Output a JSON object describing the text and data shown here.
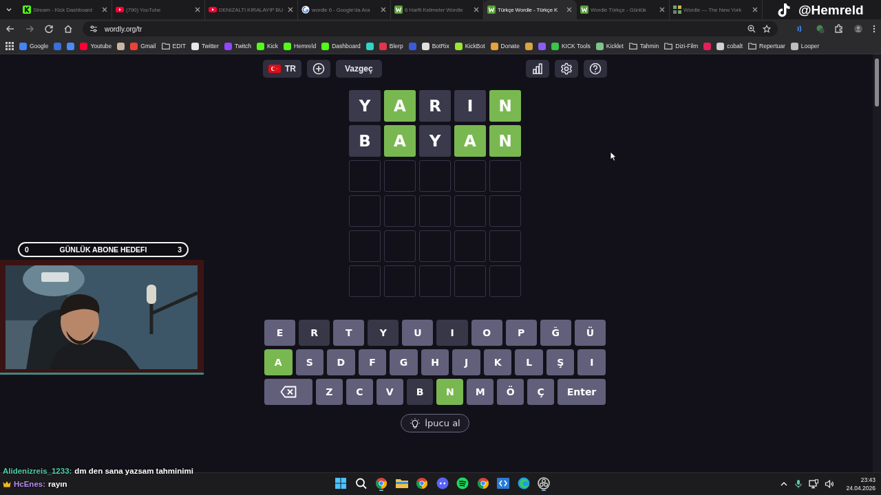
{
  "browser": {
    "tabs": [
      {
        "title": "Stream - Kick Dashboard",
        "kind": "kick",
        "selected": false
      },
      {
        "title": "(790) YouTube",
        "kind": "youtube",
        "selected": false
      },
      {
        "title": "DENIZALTI KIRALAYIP BU",
        "kind": "youtube",
        "selected": false
      },
      {
        "title": "wordle 6 - Google'da Ara",
        "kind": "google",
        "selected": false
      },
      {
        "title": "6 Harfli Kelimeler Wordle",
        "kind": "wordle",
        "selected": false
      },
      {
        "title": "Türkçe Wordle - Türkçe K",
        "kind": "wordle",
        "selected": true
      },
      {
        "title": "Wordle Türkçe - Günlük",
        "kind": "wordle",
        "selected": false
      },
      {
        "title": "Wordle — The New York",
        "kind": "grid",
        "selected": false
      }
    ],
    "address": "wordly.org/tr",
    "bookmarks": [
      {
        "label": "Google",
        "kind": "site",
        "color": "#4285f4"
      },
      {
        "kind": "site",
        "color": "#3b6fd8"
      },
      {
        "kind": "site",
        "color": "#4a8af4"
      },
      {
        "label": "Youtube",
        "kind": "site",
        "color": "#ff0033"
      },
      {
        "kind": "site",
        "color": "#c8b7a0"
      },
      {
        "label": "Gmail",
        "kind": "site",
        "color": "#ea4335"
      },
      {
        "label": "EDIT",
        "kind": "folder",
        "color": "#c7c7c7"
      },
      {
        "label": "Twitter",
        "kind": "site",
        "color": "#e7e7e7"
      },
      {
        "label": "Twitch",
        "kind": "site",
        "color": "#9146ff"
      },
      {
        "label": "Kick",
        "kind": "site",
        "color": "#53fc18"
      },
      {
        "label": "Hemreld",
        "kind": "site",
        "color": "#53fc18"
      },
      {
        "label": "Dashboard",
        "kind": "site",
        "color": "#53fc18"
      },
      {
        "kind": "site",
        "color": "#2fd6c4"
      },
      {
        "label": "Blerp",
        "kind": "site",
        "color": "#e5334b"
      },
      {
        "kind": "site",
        "color": "#3b5bdb"
      },
      {
        "label": "BotRix",
        "kind": "site",
        "color": "#e0e0e0"
      },
      {
        "label": "KickBot",
        "kind": "site",
        "color": "#9be52f"
      },
      {
        "label": "Donate",
        "kind": "site",
        "color": "#e8a23a"
      },
      {
        "kind": "site",
        "color": "#d9a441"
      },
      {
        "kind": "site",
        "color": "#8b5cf6"
      },
      {
        "label": "KICK Tools",
        "kind": "site",
        "color": "#37c74b"
      },
      {
        "label": "Kicklet",
        "kind": "site",
        "color": "#7fc48a"
      },
      {
        "label": "Tahmin",
        "kind": "folder",
        "color": "#c7c7c7"
      },
      {
        "label": "Dizi-Film",
        "kind": "folder",
        "color": "#c7c7c7"
      },
      {
        "kind": "site",
        "color": "#e0215b"
      },
      {
        "label": "cobalt",
        "kind": "site",
        "color": "#d0d0d0"
      },
      {
        "label": "Repertuar",
        "kind": "folder",
        "color": "#c7c7c7"
      },
      {
        "label": "Looper",
        "kind": "site",
        "color": "#bdbdbd"
      }
    ]
  },
  "overlay": {
    "handle": "@Hemreld",
    "goal": {
      "start": "0",
      "label": "GÜNLÜK ABONE HEDEFI",
      "end": "3"
    },
    "chat": [
      {
        "user": "Alidenizreis_1233:",
        "message": "dm den sana yazsam tahminimi",
        "color": "#4fd1a5",
        "crown": false
      },
      {
        "user": "HcEnes:",
        "message": "rayın",
        "color": "#b98cf2",
        "crown": true
      }
    ]
  },
  "game": {
    "language": "TR",
    "give_up": "Vazgeç",
    "hint": "İpucu al",
    "board": [
      [
        {
          "kind": "letter",
          "letter": "Y",
          "correct": false
        },
        {
          "kind": "letter",
          "letter": "A",
          "correct": true
        },
        {
          "kind": "letter",
          "letter": "R",
          "correct": false
        },
        {
          "kind": "letter",
          "letter": "I",
          "correct": false
        },
        {
          "kind": "letter",
          "letter": "N",
          "correct": true
        }
      ],
      [
        {
          "kind": "letter",
          "letter": "B",
          "correct": false
        },
        {
          "kind": "letter",
          "letter": "A",
          "correct": true
        },
        {
          "kind": "letter",
          "letter": "Y",
          "correct": false
        },
        {
          "kind": "letter",
          "letter": "A",
          "correct": true
        },
        {
          "kind": "letter",
          "letter": "N",
          "correct": true
        }
      ],
      [
        {
          "kind": "empty"
        },
        {
          "kind": "empty"
        },
        {
          "kind": "empty"
        },
        {
          "kind": "empty"
        },
        {
          "kind": "empty"
        }
      ],
      [
        {
          "kind": "empty"
        },
        {
          "kind": "empty"
        },
        {
          "kind": "empty"
        },
        {
          "kind": "empty"
        },
        {
          "kind": "empty"
        }
      ],
      [
        {
          "kind": "empty"
        },
        {
          "kind": "empty"
        },
        {
          "kind": "empty"
        },
        {
          "kind": "empty"
        },
        {
          "kind": "empty"
        }
      ],
      [
        {
          "kind": "empty"
        },
        {
          "kind": "empty"
        },
        {
          "kind": "empty"
        },
        {
          "kind": "empty"
        },
        {
          "kind": "empty"
        }
      ]
    ],
    "keyboard": [
      [
        {
          "kind": "letter",
          "label": "E",
          "correct": false,
          "absent": false
        },
        {
          "kind": "letter",
          "label": "R",
          "correct": false,
          "absent": true
        },
        {
          "kind": "letter",
          "label": "T",
          "correct": false,
          "absent": false
        },
        {
          "kind": "letter",
          "label": "Y",
          "correct": false,
          "absent": true
        },
        {
          "kind": "letter",
          "label": "U",
          "correct": false,
          "absent": false
        },
        {
          "kind": "letter",
          "label": "I",
          "correct": false,
          "absent": true
        },
        {
          "kind": "letter",
          "label": "O",
          "correct": false,
          "absent": false
        },
        {
          "kind": "letter",
          "label": "P",
          "correct": false,
          "absent": false
        },
        {
          "kind": "letter",
          "label": "Ğ",
          "correct": false,
          "absent": false
        },
        {
          "kind": "letter",
          "label": "Ü",
          "correct": false,
          "absent": false
        }
      ],
      [
        {
          "kind": "letter",
          "label": "A",
          "correct": true
        },
        {
          "kind": "letter",
          "label": "S",
          "correct": false,
          "absent": false
        },
        {
          "kind": "letter",
          "label": "D",
          "correct": false,
          "absent": false
        },
        {
          "kind": "letter",
          "label": "F",
          "correct": false,
          "absent": false
        },
        {
          "kind": "letter",
          "label": "G",
          "correct": false,
          "absent": false
        },
        {
          "kind": "letter",
          "label": "H",
          "correct": false,
          "absent": false
        },
        {
          "kind": "letter",
          "label": "J",
          "correct": false,
          "absent": false
        },
        {
          "kind": "letter",
          "label": "K",
          "correct": false,
          "absent": false
        },
        {
          "kind": "letter",
          "label": "L",
          "correct": false,
          "absent": false
        },
        {
          "kind": "letter",
          "label": "Ş",
          "correct": false,
          "absent": false
        },
        {
          "kind": "letter",
          "label": "I",
          "correct": false,
          "absent": false
        }
      ],
      [
        {
          "kind": "backspace"
        },
        {
          "kind": "letter",
          "label": "Z",
          "correct": false,
          "absent": false
        },
        {
          "kind": "letter",
          "label": "C",
          "correct": false,
          "absent": false
        },
        {
          "kind": "letter",
          "label": "V",
          "correct": false,
          "absent": false
        },
        {
          "kind": "letter",
          "label": "B",
          "correct": false,
          "absent": true
        },
        {
          "kind": "letter",
          "label": "N",
          "correct": true
        },
        {
          "kind": "letter",
          "label": "M",
          "correct": false,
          "absent": false
        },
        {
          "kind": "letter",
          "label": "Ö",
          "correct": false,
          "absent": false
        },
        {
          "kind": "letter",
          "label": "Ç",
          "correct": false,
          "absent": false
        },
        {
          "kind": "enter",
          "label": "Enter"
        }
      ]
    ]
  },
  "taskbar": {
    "time": "23:43",
    "date": "24.04.2026"
  }
}
